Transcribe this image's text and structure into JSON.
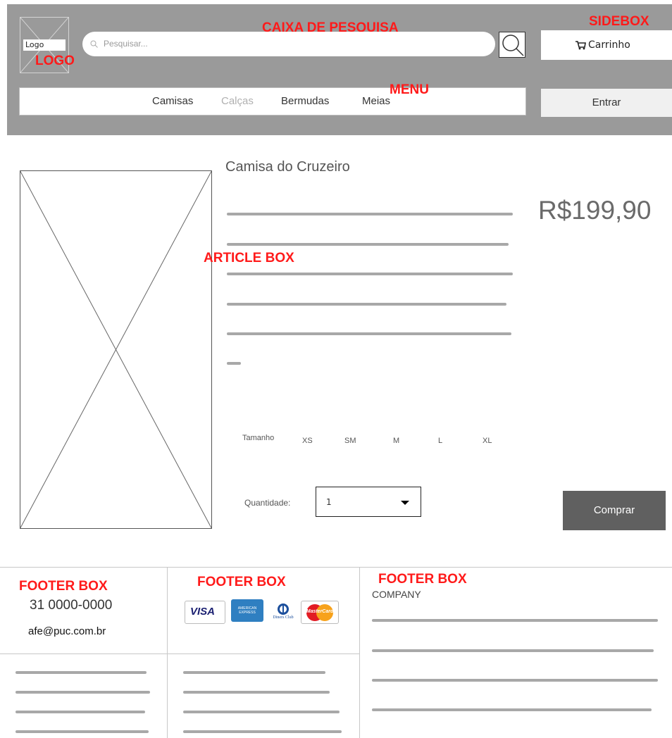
{
  "header": {
    "logo_label": "Logo",
    "search_placeholder": "Pesquisar...",
    "cart_label": "Carrinho",
    "login_label": "Entrar",
    "menu_items": [
      "Camisas",
      "Calças",
      "Bermudas",
      "Meias"
    ],
    "active_menu_item": "Calças"
  },
  "annotations": {
    "logo": "LOGO",
    "search": "CAIXA DE PESQUISA",
    "sidebox": "SIDEBOX",
    "menu": "MENU",
    "article": "ARTICLE BOX",
    "footer_1": "FOOTER BOX",
    "footer_2": "FOOTER BOX",
    "footer_3": "FOOTER BOX"
  },
  "product": {
    "title": "Camisa do Cruzeiro",
    "price": "R$199,90",
    "size_label": "Tamanho",
    "sizes": [
      "XS",
      "SM",
      "M",
      "L",
      "XL"
    ],
    "quantity_label": "Quantidade:",
    "quantity_value": "1",
    "buy_label": "Comprar"
  },
  "footer": {
    "phone": "31 0000-0000",
    "email": "afe@puc.com.br",
    "company_label": "COMPANY",
    "payment_cards": [
      {
        "name": "VISA",
        "icon": "visa-card-icon"
      },
      {
        "name": "AMERICAN EXPRESS",
        "icon": "amex-card-icon"
      },
      {
        "name": "Diners Club",
        "icon": "diners-card-icon"
      },
      {
        "name": "MasterCard",
        "icon": "mastercard-icon"
      }
    ]
  },
  "colors": {
    "header_bg": "#9a9a9a",
    "annotation_red": "#ff1a1a",
    "buy_button": "#606060",
    "inactive_menu": "#b0b0b0"
  }
}
